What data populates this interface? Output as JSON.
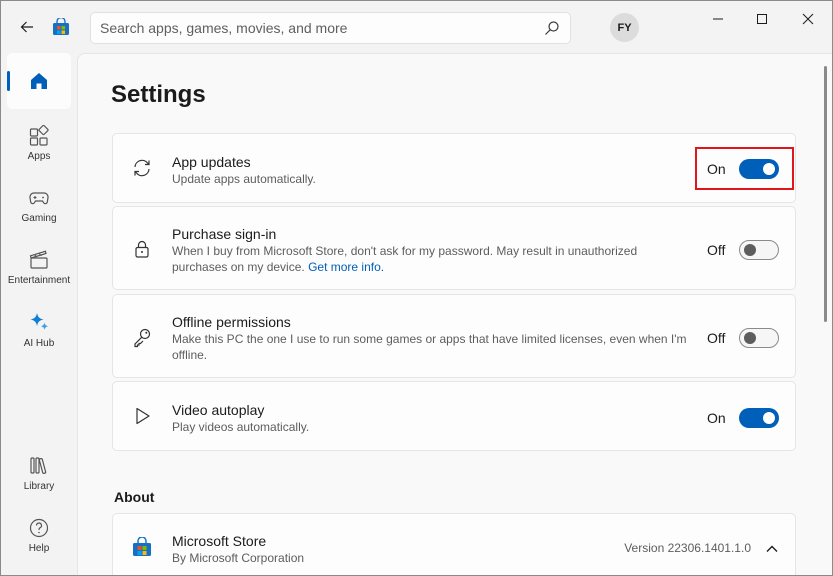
{
  "window": {
    "search_placeholder": "Search apps, games, movies, and more",
    "avatar_initials": "FY"
  },
  "sidebar": {
    "items": [
      {
        "label": "",
        "icon": "home-icon",
        "active": true
      },
      {
        "label": "Apps",
        "icon": "apps-icon"
      },
      {
        "label": "Gaming",
        "icon": "gaming-icon"
      },
      {
        "label": "Entertainment",
        "icon": "entertainment-icon"
      },
      {
        "label": "AI Hub",
        "icon": "ai-hub-icon"
      },
      {
        "label": "Library",
        "icon": "library-icon"
      },
      {
        "label": "Help",
        "icon": "help-icon"
      }
    ]
  },
  "main": {
    "title": "Settings",
    "settings": [
      {
        "title": "App updates",
        "description": "Update apps automatically.",
        "state": "On",
        "icon": "sync-icon"
      },
      {
        "title": "Purchase sign-in",
        "description": "When I buy from Microsoft Store, don't ask for my password. May result in unauthorized purchases on my device.",
        "link": "Get more info.",
        "state": "Off",
        "icon": "lock-icon"
      },
      {
        "title": "Offline permissions",
        "description": "Make this PC the one I use to run some games or apps that have limited licenses, even when I'm offline.",
        "state": "Off",
        "icon": "key-icon"
      },
      {
        "title": "Video autoplay",
        "description": "Play videos automatically.",
        "state": "On",
        "icon": "play-icon"
      }
    ],
    "about": {
      "section_title": "About",
      "app_name": "Microsoft Store",
      "publisher": "By Microsoft Corporation",
      "version": "Version 22306.1401.1.0"
    }
  },
  "colors": {
    "accent": "#005fb8",
    "highlight": "#e0161b"
  }
}
